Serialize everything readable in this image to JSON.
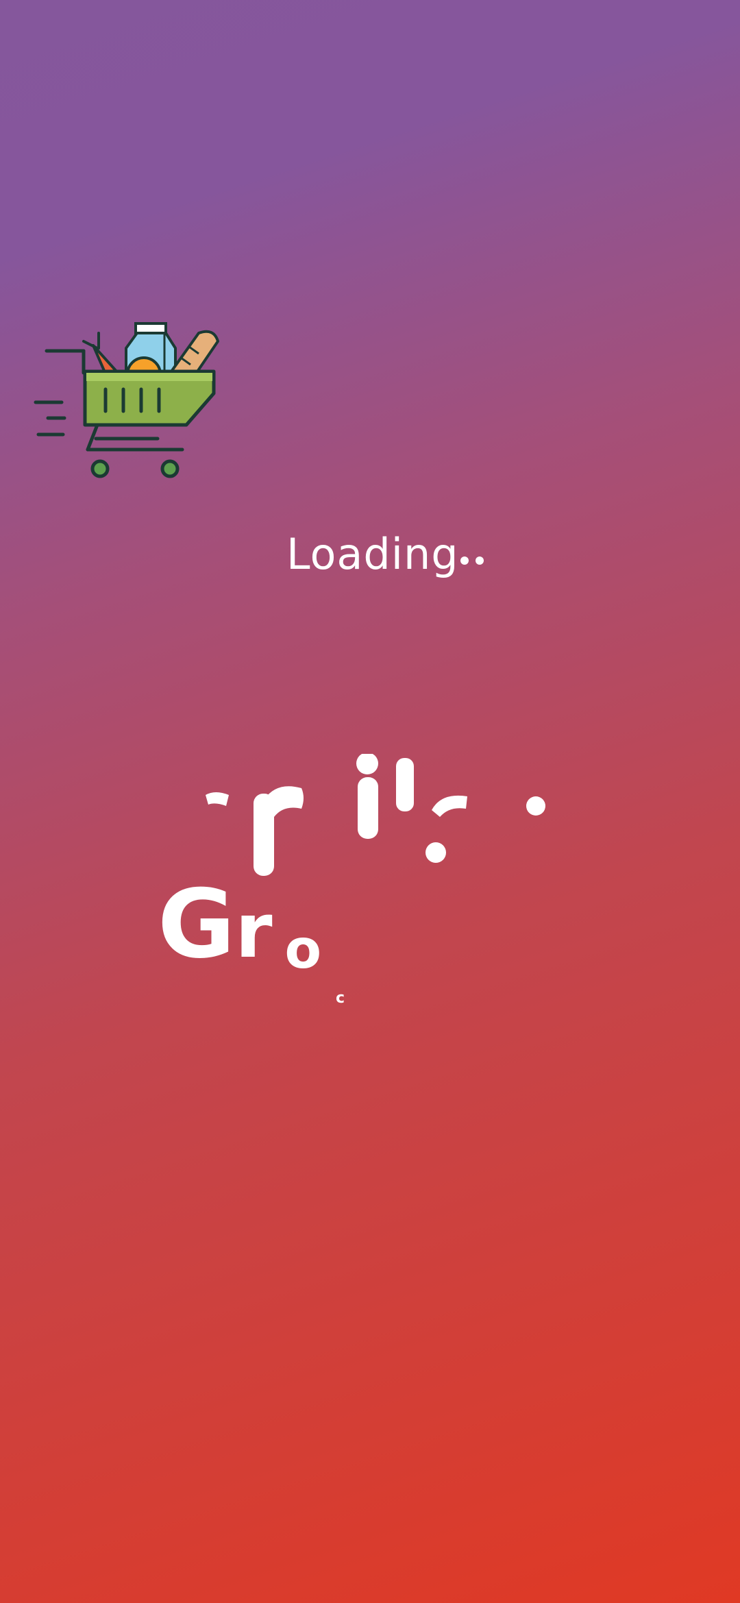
{
  "splash": {
    "status_text": "Loading",
    "brand": {
      "g": "G",
      "r": "r",
      "o": "o",
      "tail": "c"
    }
  },
  "icons": {
    "cart": "grocery-cart-icon",
    "dots": "loading-dots-icon"
  },
  "colors": {
    "gradient_start": "#85579c",
    "gradient_end": "#e03924",
    "text": "#ffffff",
    "basket_green": "#8db04a",
    "outline": "#1b3a33"
  }
}
